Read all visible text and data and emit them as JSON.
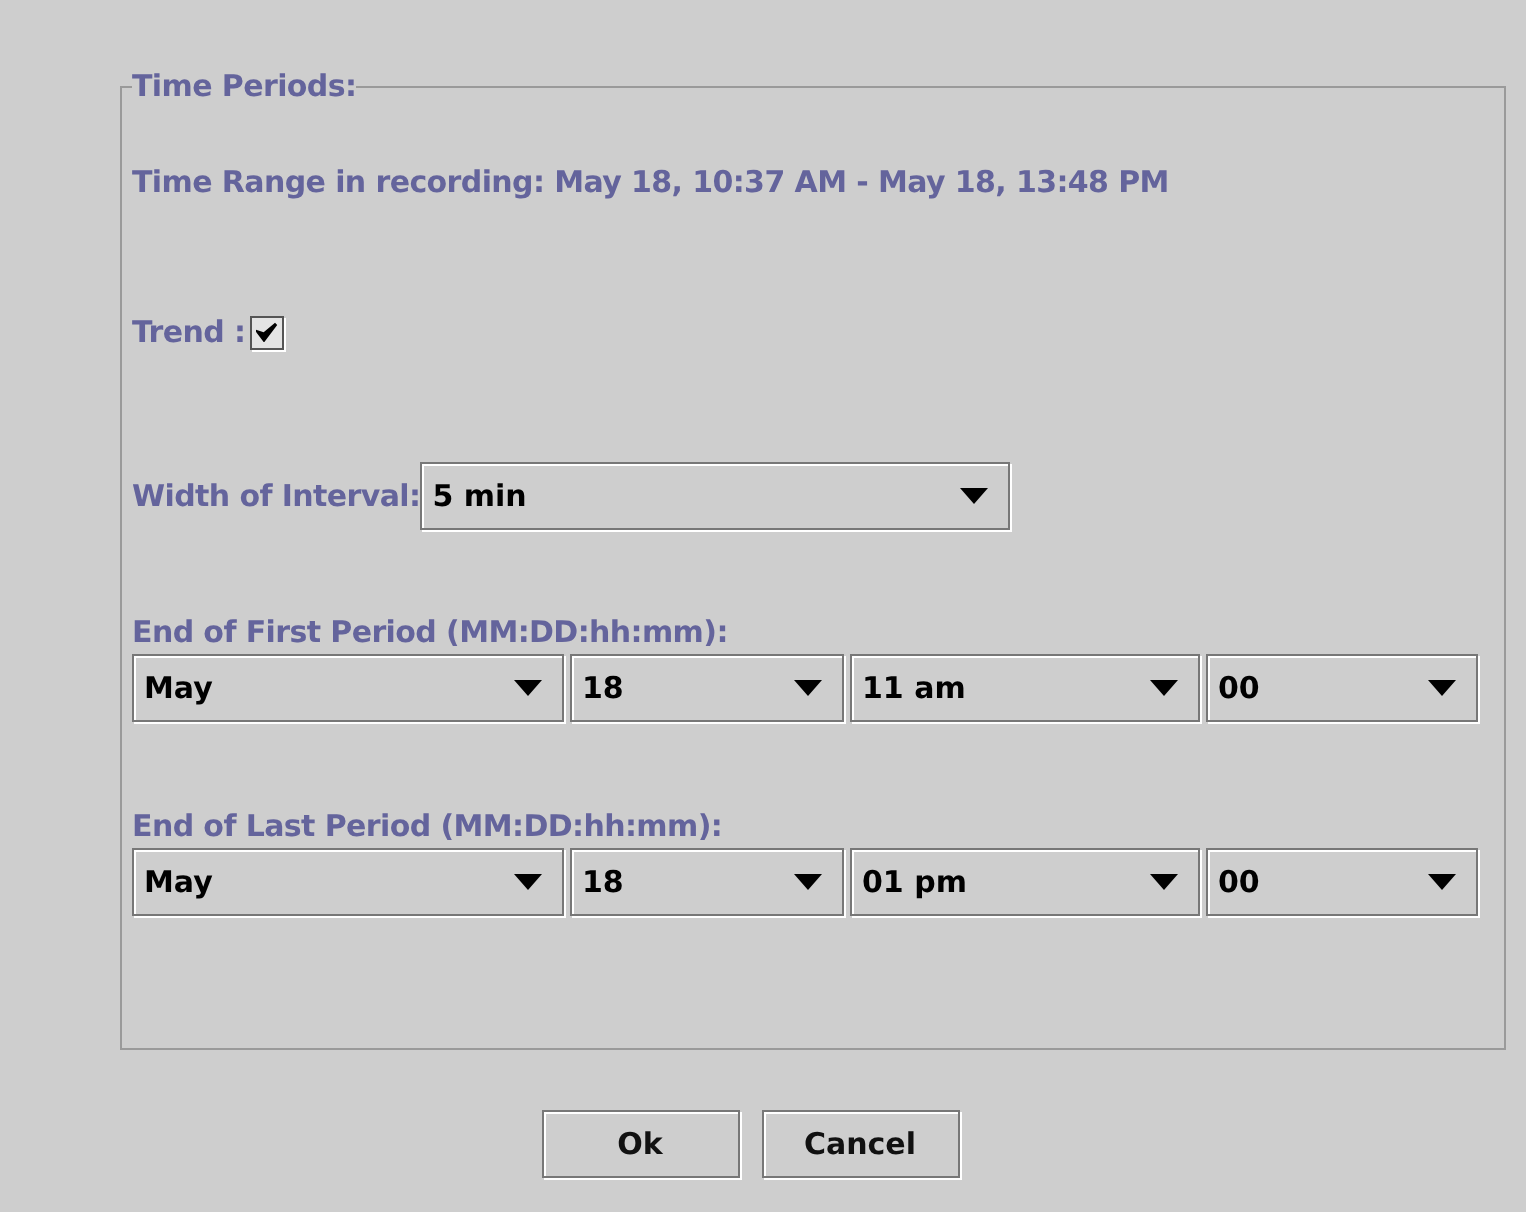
{
  "group": {
    "title": "Time Periods:"
  },
  "time_range": "Time Range in recording: May 18, 10:37 AM - May 18, 13:48 PM",
  "trend": {
    "label": "Trend :",
    "checked": true
  },
  "interval": {
    "label": "Width of Interval:",
    "value": "5 min"
  },
  "periods": [
    {
      "label": "End of First Period (MM:DD:hh:mm):",
      "fields": [
        "May",
        "18",
        "11 am",
        "00"
      ]
    },
    {
      "label": "End of Last Period (MM:DD:hh:mm):",
      "fields": [
        "May",
        "18",
        "01 pm",
        "00"
      ]
    }
  ],
  "buttons": [
    "Ok",
    "Cancel"
  ]
}
